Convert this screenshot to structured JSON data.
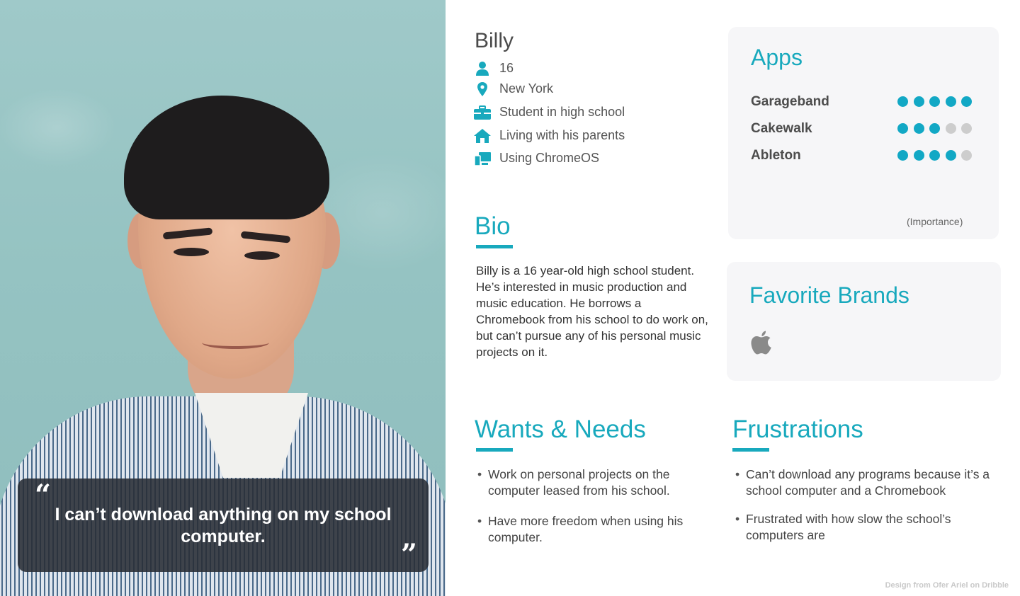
{
  "quote": {
    "open_mark": "“",
    "text": "I can’t download anything on my school computer.",
    "close_mark": "”"
  },
  "profile": {
    "name": "Billy",
    "facts": [
      {
        "icon": "person-icon",
        "text": "16"
      },
      {
        "icon": "location-pin-icon",
        "text": "New York"
      },
      {
        "icon": "briefcase-icon",
        "text": "Student in high school"
      },
      {
        "icon": "home-icon",
        "text": "Living with his parents"
      },
      {
        "icon": "devices-icon",
        "text": "Using ChromeOS"
      }
    ]
  },
  "bio": {
    "title": "Bio",
    "text": "Billy is a 16 year-old high school student. He’s interested in music production and music education. He borrows a Chromebook from his school to do work on, but can’t pursue any of his personal music projects on it."
  },
  "apps": {
    "title": "Apps",
    "items": [
      {
        "name": "Garageband",
        "importance": 5,
        "max": 5
      },
      {
        "name": "Cakewalk",
        "importance": 3,
        "max": 5
      },
      {
        "name": "Ableton",
        "importance": 4,
        "max": 5
      }
    ],
    "importance_label": "(Importance)",
    "active_color": "#12a8c5",
    "inactive_color": "#cdcdcd"
  },
  "brands": {
    "title": "Favorite Brands",
    "logos": [
      "apple-logo-icon"
    ]
  },
  "wants": {
    "title": "Wants & Needs",
    "items": [
      "Work on personal projects on the computer leased from his school.",
      "Have more freedom when using his computer."
    ]
  },
  "frustrations": {
    "title": "Frustrations",
    "items": [
      "Can’t download any programs because it’s a school computer and a Chromebook",
      "Frustrated with how slow the school’s computers are"
    ]
  },
  "credit": "Design from Ofer Ariel on Dribble",
  "theme": {
    "accent": "#18a9bd"
  }
}
